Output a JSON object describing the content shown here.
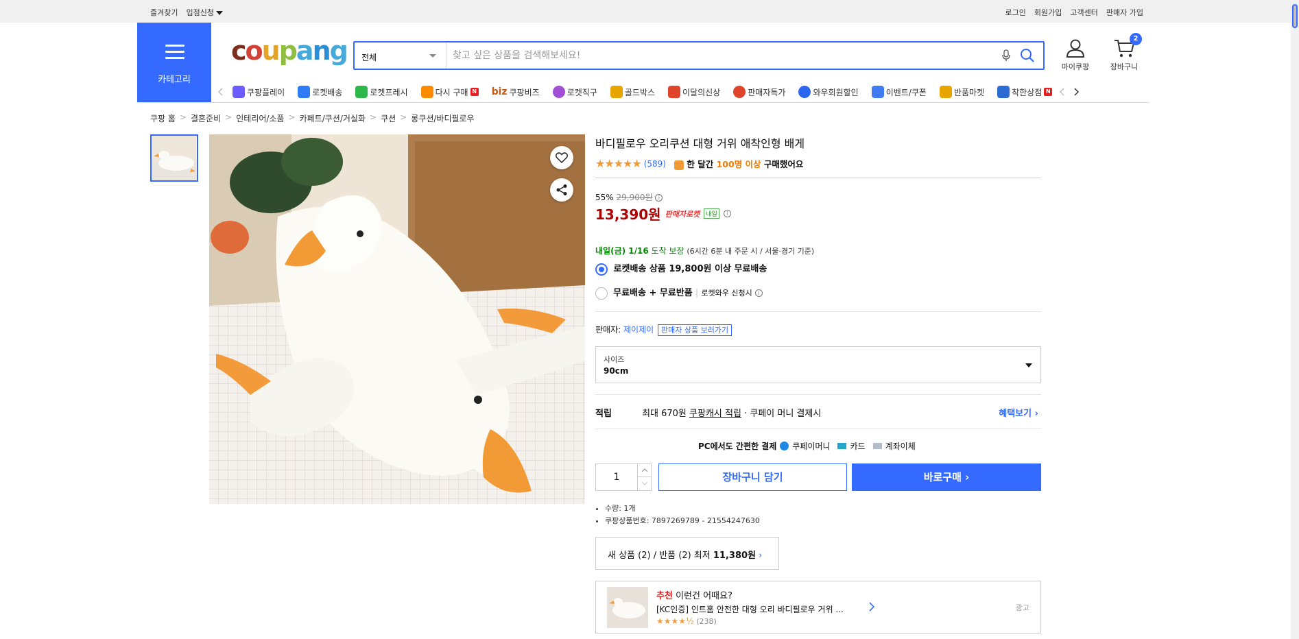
{
  "topbar": {
    "favorites": "즐겨찾기",
    "partner": "입점신청",
    "login": "로그인",
    "signup": "회원가입",
    "cs": "고객센터",
    "seller_signup": "판매자 가입"
  },
  "category_button": "카테고리",
  "logo": [
    "c",
    "o",
    "u",
    "p",
    "a",
    "n",
    "g"
  ],
  "search": {
    "category": "전체",
    "placeholder": "찾고 싶은 상품을 검색해보세요!"
  },
  "header_utils": {
    "mypage": "마이쿠팡",
    "cart": "장바구니",
    "cart_count": "2"
  },
  "nav": [
    {
      "label": "쿠팡플레이",
      "color": "#6a5cff"
    },
    {
      "label": "로켓배송",
      "color": "#2f7df6"
    },
    {
      "label": "로켓프레시",
      "color": "#2eb84c"
    },
    {
      "label": "다시 구매",
      "color": "#ff8a00",
      "new": "N"
    },
    {
      "label": "쿠팡비즈",
      "prefix": "biz",
      "color": "#c75a16"
    },
    {
      "label": "로켓직구",
      "color": "#a24fd6"
    },
    {
      "label": "골드박스",
      "color": "#e8a500"
    },
    {
      "label": "이달의신상",
      "color": "#e0442b"
    },
    {
      "label": "판매자특가",
      "color": "#e0442b"
    },
    {
      "label": "와우회원할인",
      "color": "#2c66f0"
    },
    {
      "label": "이벤트/쿠폰",
      "color": "#3f7bf5"
    },
    {
      "label": "반품마켓",
      "color": "#e8a500"
    },
    {
      "label": "착한상점",
      "color": "#2b6cd4",
      "new": "N"
    }
  ],
  "breadcrumbs": [
    "쿠팡 홈",
    "결혼준비",
    "인테리어/소품",
    "카페트/쿠션/거실화",
    "쿠션",
    "롱쿠션/바디필로우"
  ],
  "product": {
    "title": "바디필로우 오리쿠션 대형 거위 애착인형 배게",
    "rating_stars": "★★★★★",
    "review_count": "(589)",
    "purchase_prefix": "한 달간",
    "purchase_highlight": "100명 이상",
    "purchase_suffix": "구매했어요",
    "discount_rate": "55%",
    "original_price": "29,900원",
    "sale_price": "13,390원",
    "rocket_label": "판매자로켓",
    "tomorrow_badge": "내일",
    "delivery_date": "내일(금) 1/16",
    "delivery_guarantee": "도착 보장",
    "delivery_note": "(6시간 6분 내 주문 시 / 서울·경기 기준)",
    "ship_option1": "로켓배송 상품 19,800원 이상 무료배송",
    "ship_option2": "무료배송 + 무료반품",
    "ship_option2_note": "로켓와우 신청시",
    "seller_label": "판매자:",
    "seller_name": "제이제이",
    "seller_products": "판매자 상품 보러가기",
    "size_label": "사이즈",
    "size_value": "90cm",
    "reward_label": "적립",
    "reward_text1": "최대 670원",
    "reward_link": "쿠팡캐시 적립",
    "reward_text2": "· 쿠페이 머니 결제시",
    "benefits": "혜택보기",
    "pc_pay": "PC에서도 간편한 결제",
    "pay_money": "쿠페이머니",
    "pay_card": "카드",
    "pay_transfer": "계좌이체",
    "quantity": "1",
    "add_to_cart": "장바구니 담기",
    "buy_now": "바로구매",
    "bullet_qty": "수량: 1개",
    "bullet_id": "쿠팡상품번호: 7897269789 - 21554247630",
    "new_used": "새 상품 (2) / 반품 (2) 최저",
    "new_used_price": "11,380원"
  },
  "recommend": {
    "tag": "추천",
    "title": "이런건 어때요?",
    "item": "[KC인증] 인트홈 안전한 대형 오리 바디필로우 거위 ...",
    "stars": "★★★★½",
    "count": "(238)",
    "ad": "광고"
  }
}
